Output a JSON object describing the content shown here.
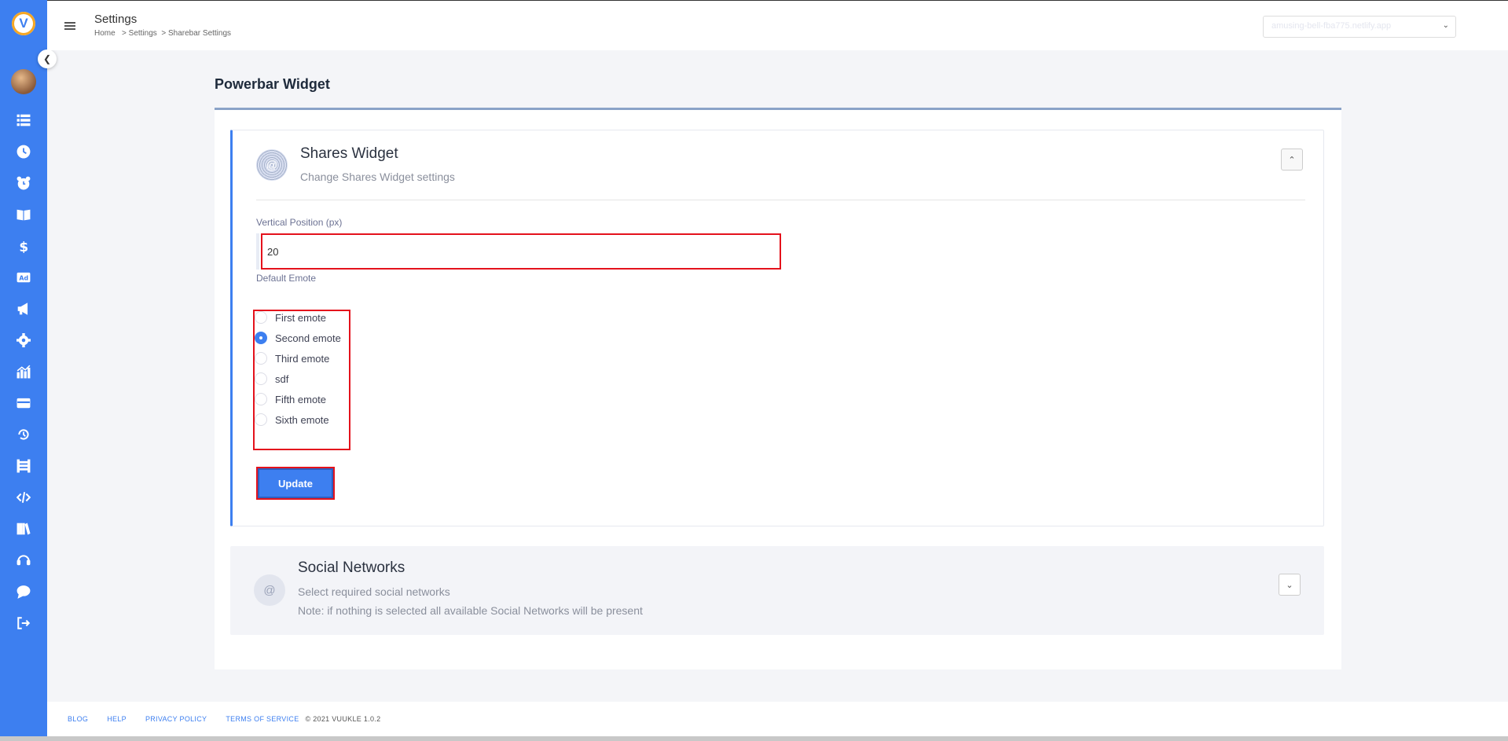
{
  "app": {
    "logo_letter": "V"
  },
  "header": {
    "title": "Settings",
    "breadcrumb": [
      "Home",
      "> Settings",
      "> Sharebar Settings"
    ],
    "site_select": "amusing-bell-fba775.netlify.app"
  },
  "page": {
    "heading": "Powerbar Widget"
  },
  "shares_widget": {
    "icon": "@",
    "title": "Shares Widget",
    "subtitle": "Change Shares Widget settings",
    "vertical_label": "Vertical Position (px)",
    "vertical_value": "20",
    "emote_label": "Default Emote",
    "emotes": [
      "First emote",
      "Second emote",
      "Third emote",
      "sdf",
      "Fifth emote",
      "Sixth emote"
    ],
    "selected_emote_index": 1,
    "update_label": "Update"
  },
  "social": {
    "icon": "@",
    "title": "Social Networks",
    "subtitle": "Select required social networks",
    "note": "Note: if nothing is selected all available Social Networks will be present"
  },
  "footer": {
    "blog": "BLOG",
    "help": "HELP",
    "privacy": "PRIVACY POLICY",
    "terms": "TERMS OF SERVICE",
    "copyright": "© 2021 VUUKLE 1.0.2"
  },
  "colors": {
    "accent": "#3d7ff0",
    "highlight": "#e4121c"
  }
}
